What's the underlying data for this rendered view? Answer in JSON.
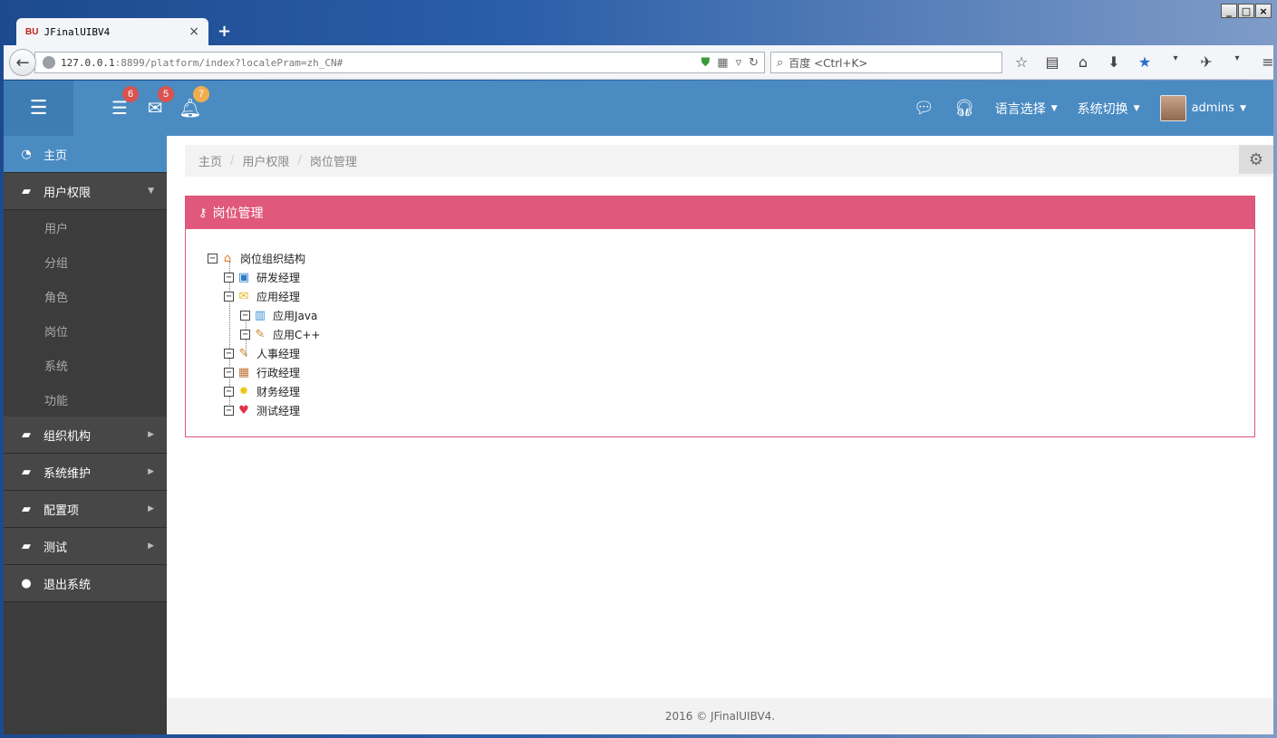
{
  "browser": {
    "tab_favicon": "BU",
    "tab_title": "JFinalUIBV4",
    "tab_close": "×",
    "new_tab": "+",
    "url_host": "127.0.0.1",
    "url_rest": ":8899/platform/index?localePram=zh_CN#",
    "search_placeholder": "百度 <Ctrl+K>",
    "window_buttons": [
      "_",
      "□",
      "×"
    ]
  },
  "topbar": {
    "menu_icon": "menu-icon",
    "badges": [
      {
        "icon": "tasks-icon",
        "count": "6",
        "color": "red"
      },
      {
        "icon": "envelope-icon",
        "count": "5",
        "color": "red"
      },
      {
        "icon": "bell-icon",
        "count": "7",
        "color": "orange"
      }
    ],
    "language_label": "语言选择",
    "system_label": "系统切换",
    "user_name": "admins"
  },
  "sidebar": {
    "items": [
      {
        "label": "主页",
        "icon": "dashboard-icon"
      },
      {
        "label": "用户权限",
        "icon": "book-icon"
      },
      {
        "label": "组织机构",
        "icon": "book-icon"
      },
      {
        "label": "系统维护",
        "icon": "book-icon"
      },
      {
        "label": "配置项",
        "icon": "book-icon"
      },
      {
        "label": "测试",
        "icon": "book-icon"
      },
      {
        "label": "退出系统",
        "icon": "user-icon"
      }
    ],
    "sub_items": [
      "用户",
      "分组",
      "角色",
      "岗位",
      "系统",
      "功能"
    ]
  },
  "breadcrumb": [
    "主页",
    "用户权限",
    "岗位管理"
  ],
  "panel": {
    "title": "岗位管理"
  },
  "tree": {
    "root": "岗位组织结构",
    "children": [
      "研发经理",
      "应用经理",
      "人事经理",
      "行政经理",
      "财务经理",
      "测试经理"
    ],
    "grandchildren": [
      "应用Java",
      "应用C++"
    ]
  },
  "footer": {
    "text": "2016 © JFinalUIBV4."
  },
  "colors": {
    "topbar": "#4a8bc2",
    "panel_head": "#e0587b",
    "sidebar": "#3c3c3c"
  }
}
